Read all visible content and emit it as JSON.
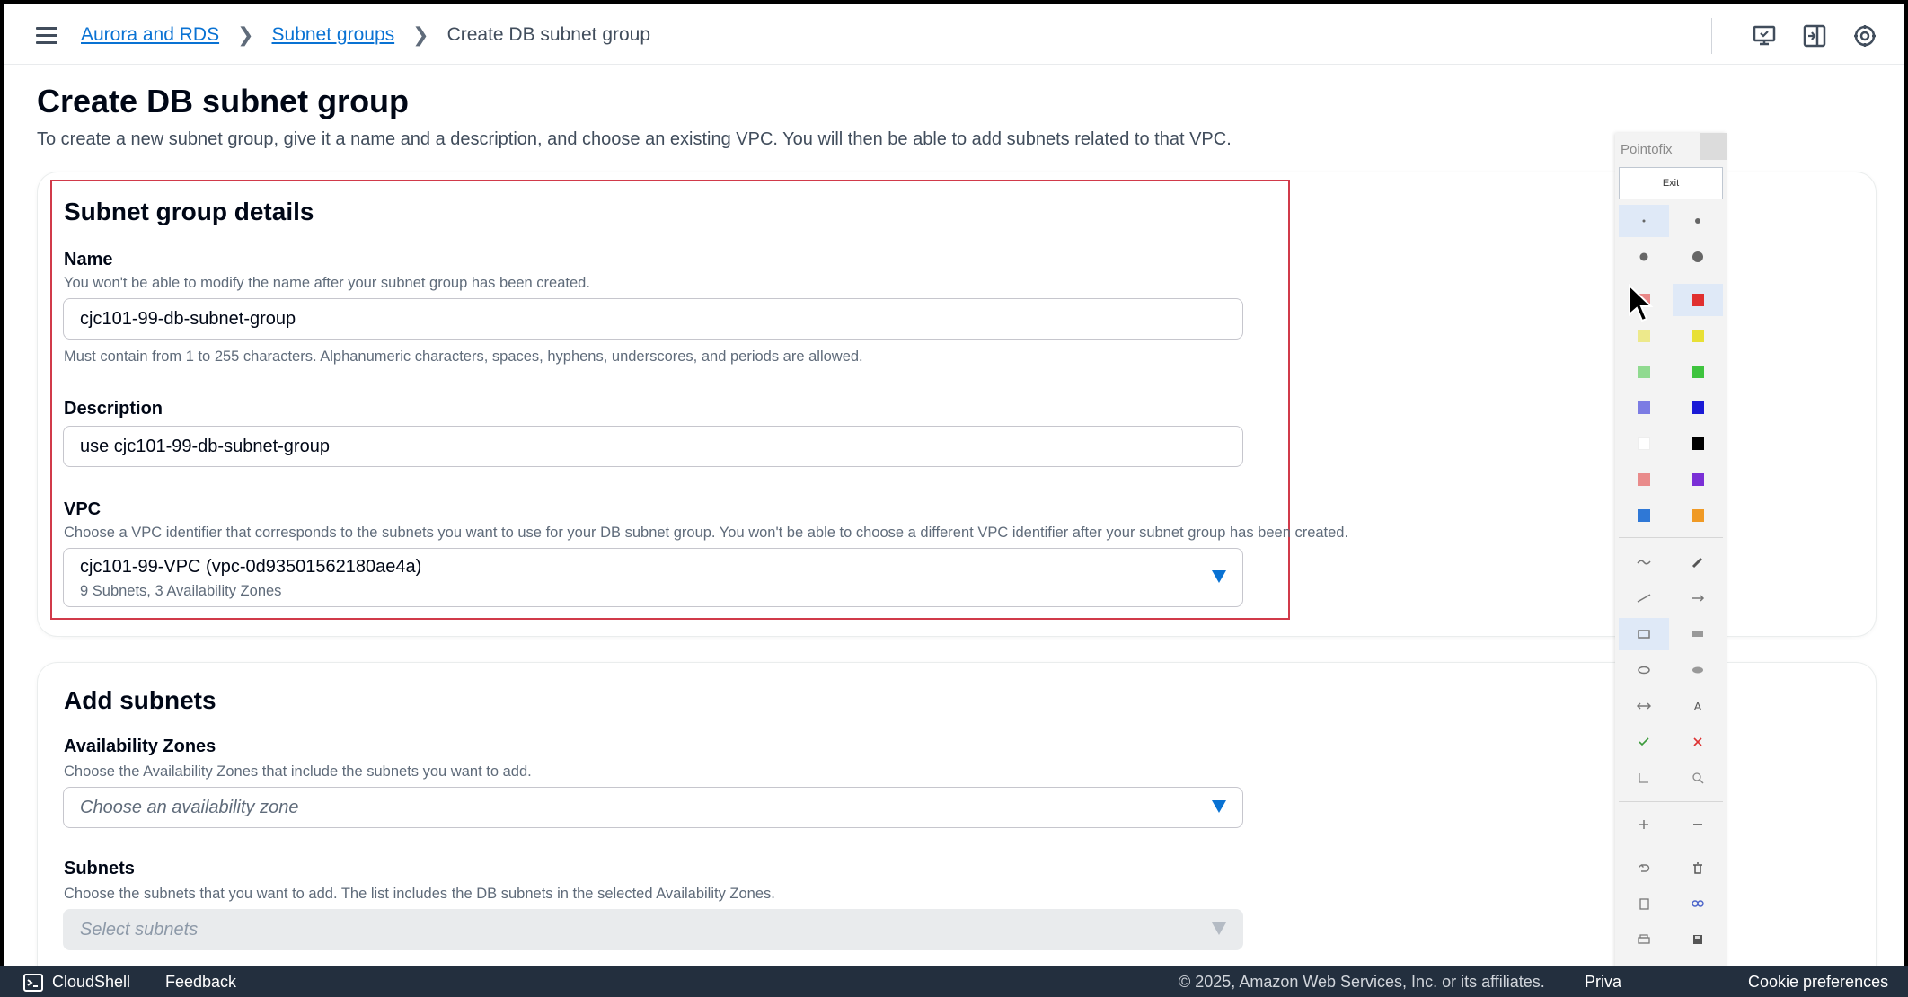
{
  "breadcrumb": {
    "items": [
      "Aurora and RDS",
      "Subnet groups"
    ],
    "current": "Create DB subnet group"
  },
  "page": {
    "title": "Create DB subnet group",
    "description": "To create a new subnet group, give it a name and a description, and choose an existing VPC. You will then be able to add subnets related to that VPC."
  },
  "details": {
    "title": "Subnet group details",
    "name_label": "Name",
    "name_desc": "You won't be able to modify the name after your subnet group has been created.",
    "name_value": "cjc101-99-db-subnet-group",
    "name_constraint": "Must contain from 1 to 255 characters. Alphanumeric characters, spaces, hyphens, underscores, and periods are allowed.",
    "desc_label": "Description",
    "desc_value": "use cjc101-99-db-subnet-group",
    "vpc_label": "VPC",
    "vpc_desc": "Choose a VPC identifier that corresponds to the subnets you want to use for your DB subnet group. You won't be able to choose a different VPC identifier after your subnet group has been created.",
    "vpc_value": "cjc101-99-VPC (vpc-0d93501562180ae4a)",
    "vpc_sub": "9 Subnets, 3 Availability Zones"
  },
  "add_subnets": {
    "title": "Add subnets",
    "az_label": "Availability Zones",
    "az_desc": "Choose the Availability Zones that include the subnets you want to add.",
    "az_placeholder": "Choose an availability zone",
    "subnets_label": "Subnets",
    "subnets_desc": "Choose the subnets that you want to add. The list includes the DB subnets in the selected Availability Zones.",
    "subnets_placeholder": "Select subnets"
  },
  "pointofix": {
    "title": "Pointofix",
    "exit_label": "Exit",
    "colors": [
      "#e03030",
      "#e8e035",
      "#3ec43e",
      "#1a1ad6",
      "#ffffff",
      "#000000",
      "#e98b8b",
      "#7a2fd6",
      "#2f78d6",
      "#f09a25"
    ]
  },
  "footer": {
    "cloudshell": "CloudShell",
    "feedback": "Feedback",
    "copyright": "© 2025, Amazon Web Services, Inc. or its affiliates.",
    "privacy": "Priva",
    "cookies": "Cookie preferences"
  },
  "colors": {
    "link": "#0972d3",
    "highlight": "#d13a4a",
    "footer_bg": "#232f3e"
  }
}
